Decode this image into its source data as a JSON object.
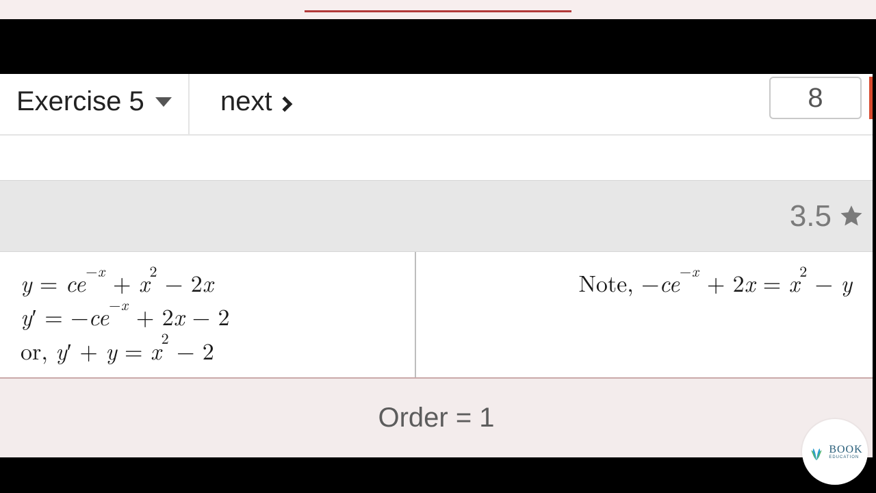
{
  "navbar": {
    "exercise_label": "Exercise 5",
    "next_label": "next",
    "page_number": "8"
  },
  "rating": {
    "value": "3.5"
  },
  "math": {
    "left_line1_html": "<span class='it'>y</span> = <span class='it'>c</span><span class='it'>e</span><sup class='neg-exp'>−<span class='it'>x</span></sup> + <span class='it'>x</span><sup>2</sup> − 2<span class='it'>x</span>",
    "left_line2_html": "<span class='it'>y</span>′ = −<span class='it'>c</span><span class='it'>e</span><sup class='neg-exp'>−<span class='it'>x</span></sup> + 2<span class='it'>x</span> − 2",
    "left_line3_html": "or, <span class='it'>y</span>′ + <span class='it'>y</span> = <span class='it'>x</span><sup>2</sup> − 2",
    "right_line_html": "Note, −<span class='it'>c</span><span class='it'>e</span><sup class='neg-exp'>−<span class='it'>x</span></sup> + 2<span class='it'>x</span> = <span class='it'>x</span><sup>2</sup> − <span class='it'>y</span>"
  },
  "footer": {
    "order_text": "Order = 1"
  },
  "logo": {
    "brand": "BOOK",
    "sub": "EDUCATION"
  }
}
